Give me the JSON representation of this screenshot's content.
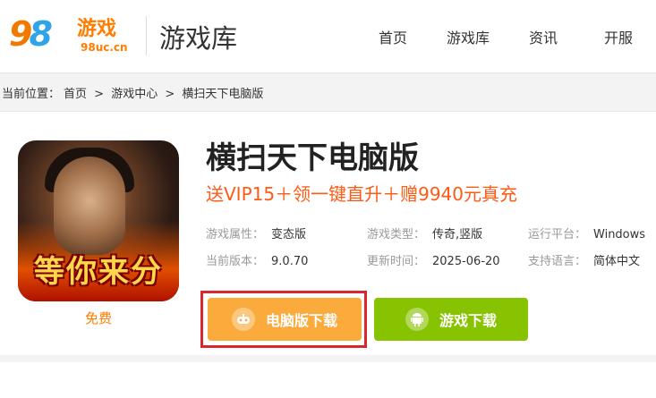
{
  "header": {
    "logo": {
      "digits": "98",
      "game_text": "游戏",
      "url": "98uc.cn"
    },
    "section_title": "游戏库",
    "nav": [
      "首页",
      "游戏库",
      "资讯",
      "开服"
    ]
  },
  "breadcrumb": {
    "prefix": "当前位置：",
    "items": [
      "首页",
      "游戏中心",
      "横扫天下电脑版"
    ],
    "separator": ">"
  },
  "game": {
    "icon_text": "等你来分",
    "free_label": "免费",
    "title": "横扫天下电脑版",
    "promo": "送VIP15＋领一键直升＋赠9940元真充",
    "attributes": [
      {
        "key": "游戏属性：",
        "value": "变态版"
      },
      {
        "key": "游戏类型：",
        "value": "传奇,竖版"
      },
      {
        "key": "运行平台：",
        "value": "Windows"
      },
      {
        "key": "当前版本：",
        "value": "9.0.70"
      },
      {
        "key": "更新时间：",
        "value": "2025-06-20"
      },
      {
        "key": "支持语言：",
        "value": "简体中文"
      }
    ],
    "buttons": {
      "pc_download": "电脑版下载",
      "android_download": "游戏下载"
    }
  },
  "colors": {
    "accent_orange": "#ff7d00",
    "promo_red": "#ff5a14",
    "pc_button": "#fbaa3c",
    "android_button": "#87c300",
    "highlight_border": "#d8272d"
  }
}
